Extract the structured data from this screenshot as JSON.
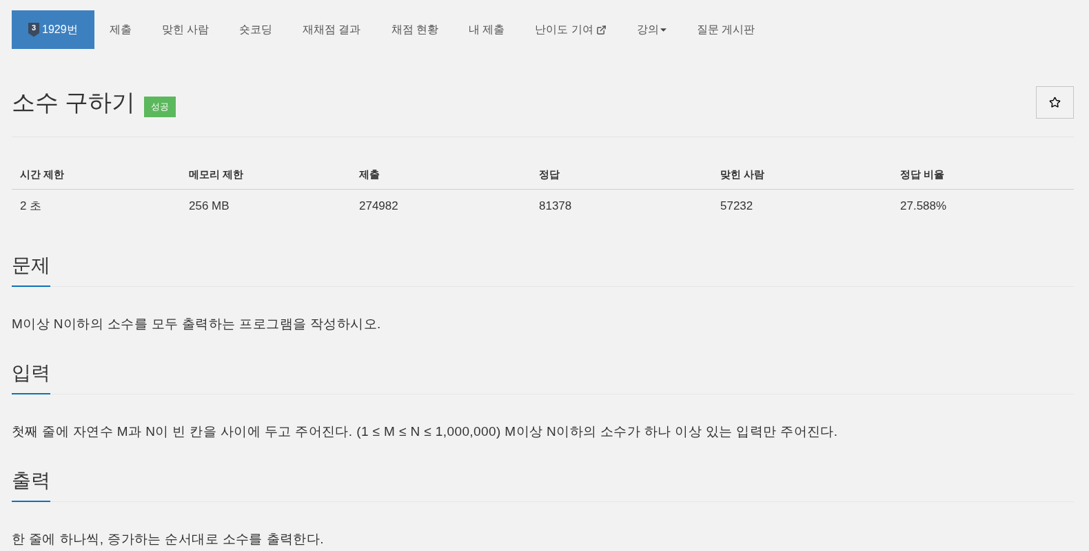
{
  "nav": {
    "problem": {
      "tier": "3",
      "label": "1929번",
      "selected": true
    },
    "tabs": [
      {
        "label": "제출",
        "kind": "link",
        "selected": false
      },
      {
        "label": "맞힌 사람",
        "kind": "link",
        "selected": false
      },
      {
        "label": "숏코딩",
        "kind": "link",
        "selected": false
      },
      {
        "label": "재채점 결과",
        "kind": "link",
        "selected": false
      },
      {
        "label": "채점 현황",
        "kind": "link",
        "selected": false
      },
      {
        "label": "내 제출",
        "kind": "link",
        "selected": false
      },
      {
        "label": "난이도 기여",
        "kind": "external",
        "selected": false
      },
      {
        "label": "강의",
        "kind": "dropdown",
        "selected": false
      },
      {
        "label": "질문 게시판",
        "kind": "link",
        "selected": false
      }
    ]
  },
  "title": {
    "text": "소수 구하기",
    "badge": {
      "label": "성공",
      "kind": "success"
    }
  },
  "info_table": {
    "columns": [
      "시간 제한",
      "메모리 제한",
      "제출",
      "정답",
      "맞힌 사람",
      "정답 비율"
    ],
    "rows": [
      [
        "2 초",
        "256 MB",
        "274982",
        "81378",
        "57232",
        "27.588%"
      ]
    ]
  },
  "sections": [
    {
      "heading": "문제",
      "body": "M이상 N이하의 소수를 모두 출력하는 프로그램을 작성하시오."
    },
    {
      "heading": "입력",
      "body": "첫째 줄에 자연수 M과 N이 빈 칸을 사이에 두고 주어진다. (1 ≤ M ≤ N ≤ 1,000,000) M이상 N이하의 소수가 하나 이상 있는 입력만 주어진다."
    },
    {
      "heading": "출력",
      "body": "한 줄에 하나씩, 증가하는 순서대로 소수를 출력한다."
    }
  ]
}
